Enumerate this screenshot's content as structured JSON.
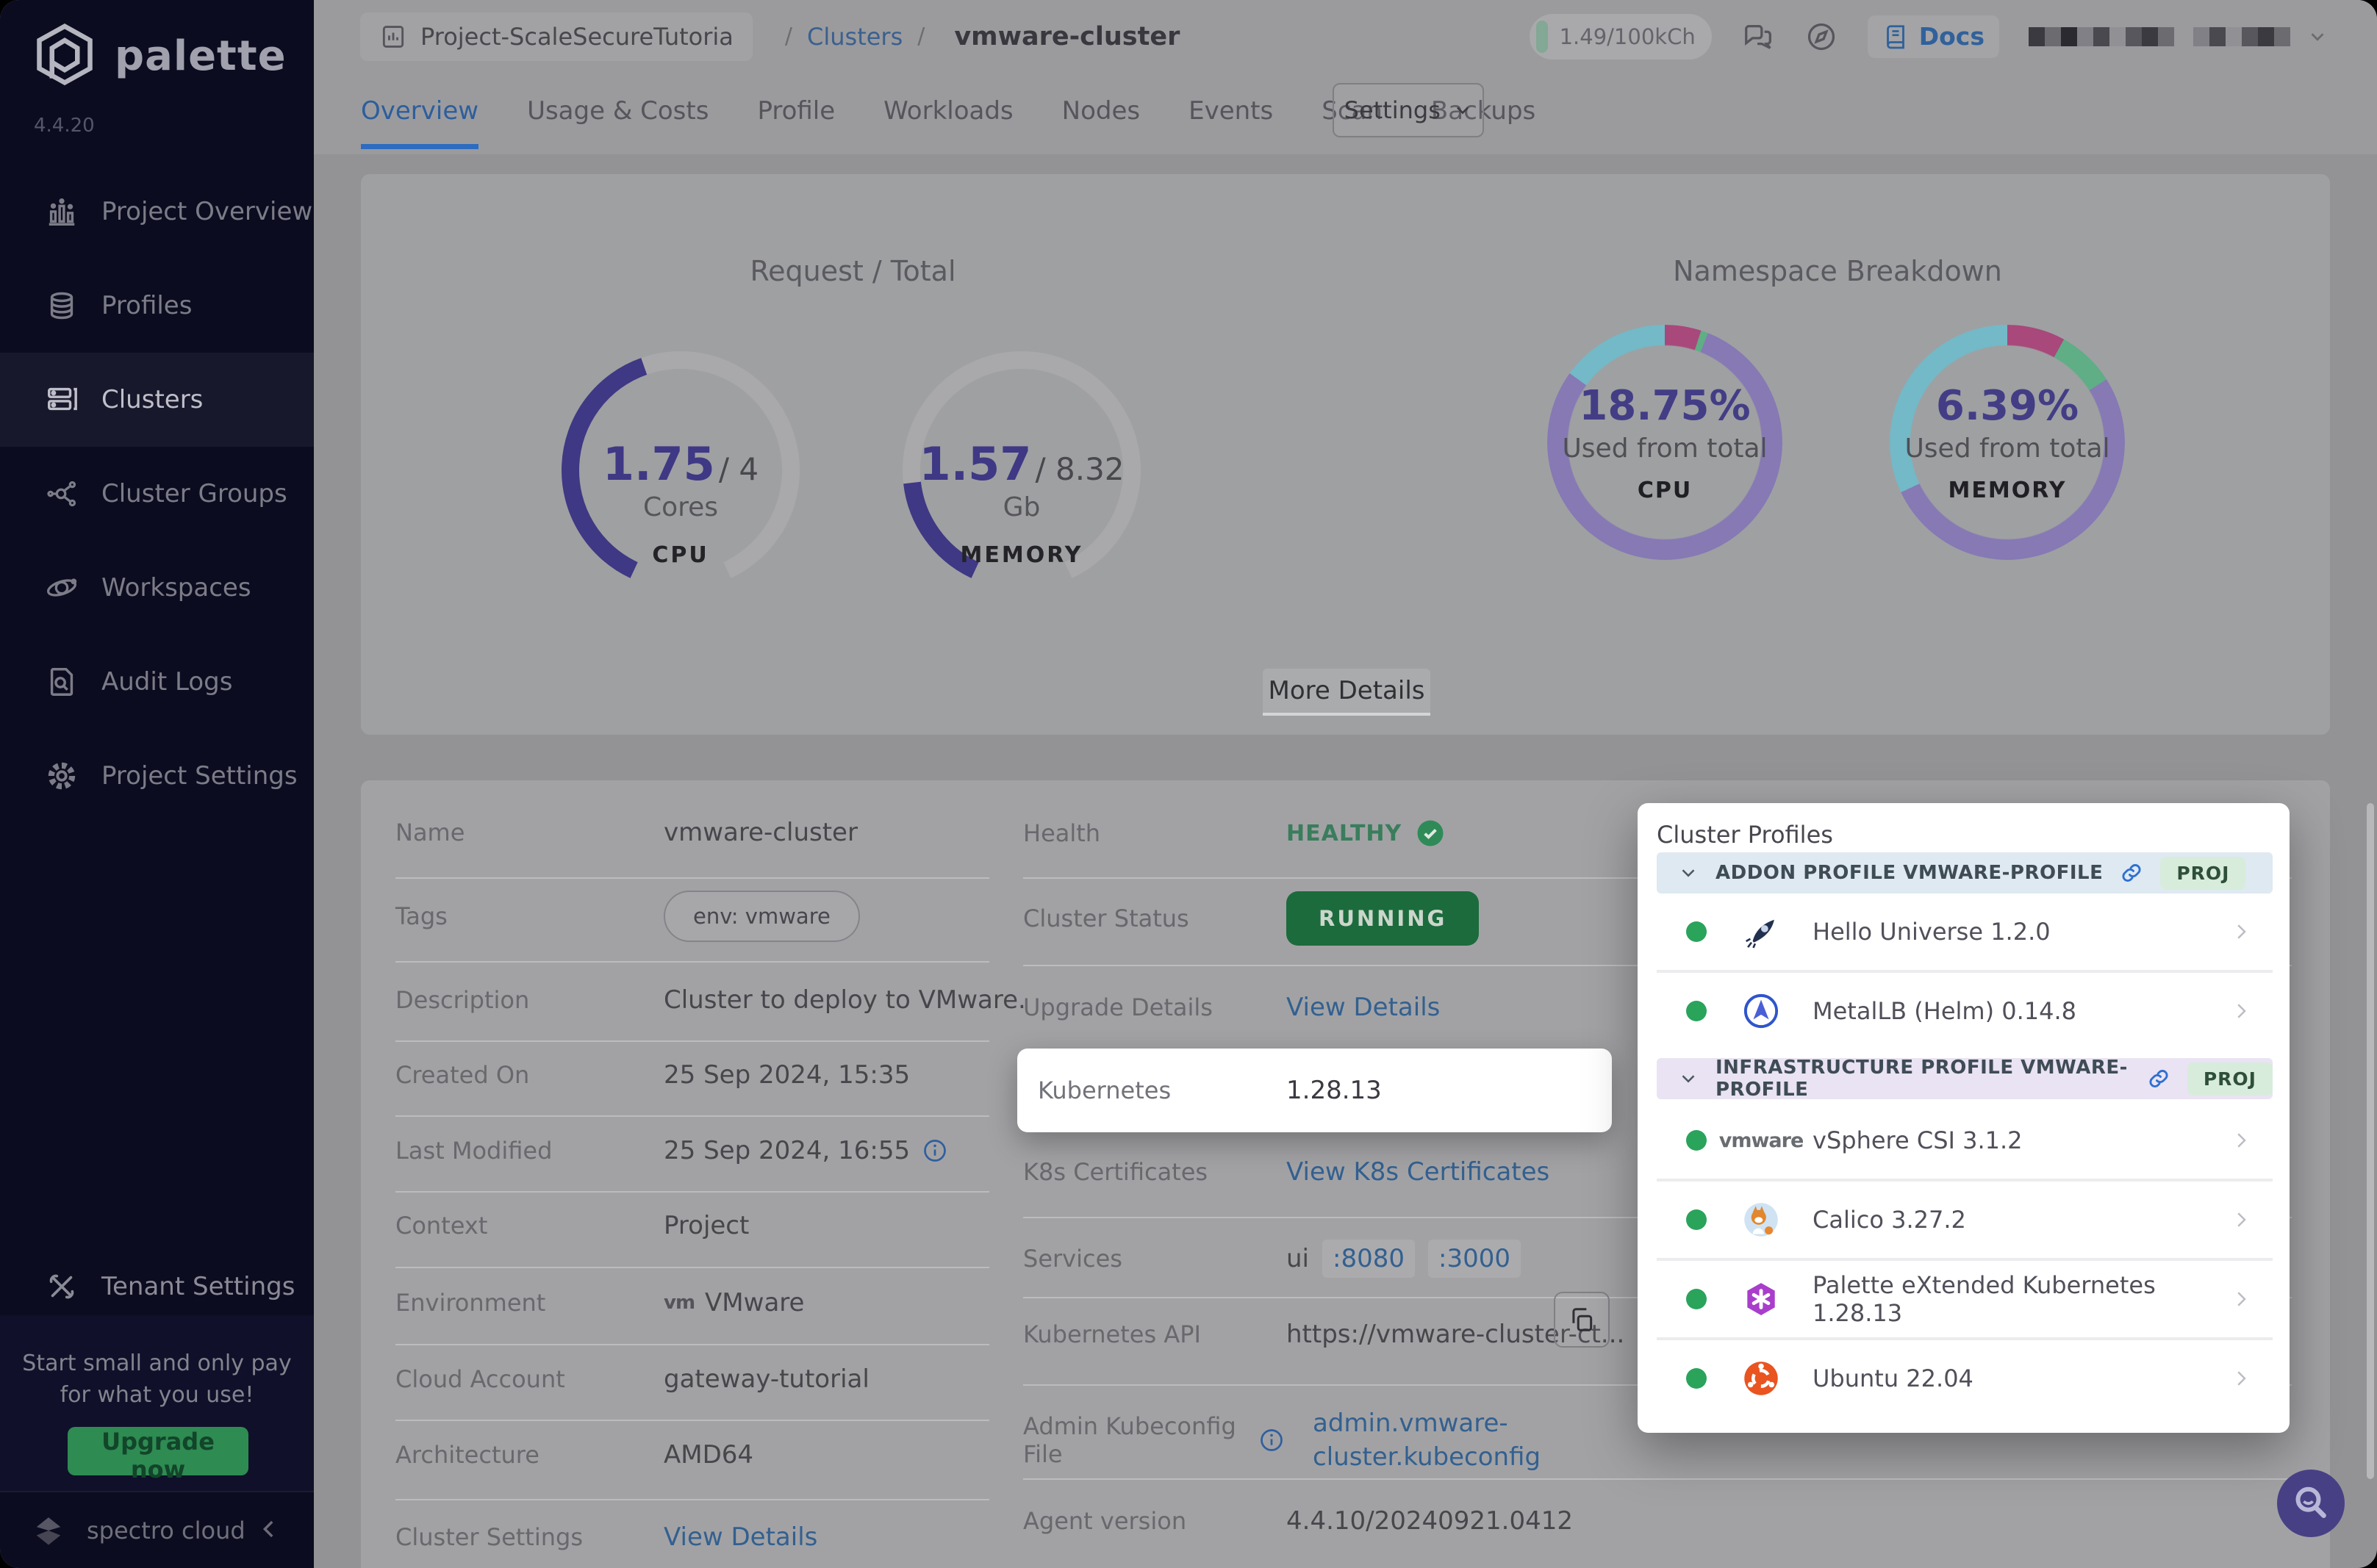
{
  "brand": {
    "name": "palette",
    "version": "4.4.20",
    "footer_company": "spectro cloud"
  },
  "sidebar": {
    "items": [
      {
        "label": "Project Overview",
        "icon": "bar-chart-icon",
        "active": false
      },
      {
        "label": "Profiles",
        "icon": "layers-icon",
        "active": false
      },
      {
        "label": "Clusters",
        "icon": "clusters-icon",
        "active": true
      },
      {
        "label": "Cluster Groups",
        "icon": "network-icon",
        "active": false
      },
      {
        "label": "Workspaces",
        "icon": "orbit-icon",
        "active": false
      },
      {
        "label": "Audit Logs",
        "icon": "audit-log-icon",
        "active": false
      },
      {
        "label": "Project Settings",
        "icon": "gear-icon",
        "active": false
      }
    ],
    "tenant_settings": {
      "label": "Tenant Settings",
      "icon": "tools-icon"
    },
    "upsell": {
      "line1": "Start small and only pay",
      "line2": "for what you use!",
      "cta": "Upgrade now"
    }
  },
  "topbar": {
    "project_chip": "Project-ScaleSecureTutoria",
    "breadcrumb": {
      "sep": "/",
      "link": "Clusters",
      "current": "vmware-cluster"
    },
    "credits": "1.49/100kCh",
    "docs_label": "Docs"
  },
  "tabs": {
    "items": [
      "Overview",
      "Usage & Costs",
      "Profile",
      "Workloads",
      "Nodes",
      "Events",
      "Scan",
      "Backups"
    ],
    "active": "Overview",
    "settings_button": "Settings"
  },
  "overview": {
    "title_left": "Request / Total",
    "title_right": "Namespace Breakdown",
    "more_details": "More Details"
  },
  "chart_data": [
    {
      "type": "gauge",
      "group": "Request / Total",
      "label": "CPU",
      "value": 1.75,
      "total": 4,
      "unit": "Cores",
      "value_display": "1.75",
      "total_display": "/ 4",
      "fill_color": "#3f3884"
    },
    {
      "type": "gauge",
      "group": "Request / Total",
      "label": "MEMORY",
      "value": 1.57,
      "total": 8.32,
      "unit": "Gb",
      "value_display": "1.57",
      "total_display": "/ 8.32",
      "fill_color": "#3f3884"
    },
    {
      "type": "donut",
      "group": "Namespace Breakdown",
      "label": "CPU",
      "center_value": "18.75%",
      "center_caption": "Used from total",
      "segments": [
        {
          "color": "#a8487b",
          "pct": 5
        },
        {
          "color": "#5fae85",
          "pct": 1
        },
        {
          "color": "#8679b4",
          "pct": 79
        },
        {
          "color": "#73b9c7",
          "pct": 15
        }
      ]
    },
    {
      "type": "donut",
      "group": "Namespace Breakdown",
      "label": "MEMORY",
      "center_value": "6.39%",
      "center_caption": "Used from total",
      "segments": [
        {
          "color": "#a8487b",
          "pct": 8
        },
        {
          "color": "#5fae85",
          "pct": 8
        },
        {
          "color": "#8679b4",
          "pct": 52
        },
        {
          "color": "#73b9c7",
          "pct": 32
        }
      ]
    }
  ],
  "details": {
    "left": [
      {
        "label": "Name",
        "value": "vmware-cluster"
      },
      {
        "label": "Tags",
        "value": "env: vmware"
      },
      {
        "label": "Description",
        "value": "Cluster to deploy to VMware."
      },
      {
        "label": "Created On",
        "value": "25 Sep 2024, 15:35"
      },
      {
        "label": "Last Modified",
        "value": "25 Sep 2024, 16:55"
      },
      {
        "label": "Context",
        "value": "Project"
      },
      {
        "label": "Environment",
        "value": "VMware",
        "logo": "vm"
      },
      {
        "label": "Cloud Account",
        "value": "gateway-tutorial"
      },
      {
        "label": "Architecture",
        "value": "AMD64"
      },
      {
        "label": "Cluster Settings",
        "value": "View Details"
      }
    ],
    "right": [
      {
        "label": "Health",
        "value": "HEALTHY"
      },
      {
        "label": "Cluster Status",
        "value": "RUNNING"
      },
      {
        "label": "Upgrade Details",
        "value": "View Details"
      },
      {
        "label": "Kubernetes",
        "value": "1.28.13"
      },
      {
        "label": "K8s Certificates",
        "value": "View K8s Certificates"
      },
      {
        "label": "Services",
        "name": "ui",
        "ports": [
          ":8080",
          ":3000"
        ]
      },
      {
        "label": "Kubernetes API",
        "value": "https://vmware-cluster-ct..."
      },
      {
        "label": "Admin Kubeconfig File",
        "lines": [
          "admin.vmware-",
          "cluster.kubeconfig"
        ]
      },
      {
        "label": "Agent version",
        "value": "4.4.10/20240921.0412"
      }
    ]
  },
  "profiles_panel": {
    "title": "Cluster Profiles",
    "sections": [
      {
        "header": "ADDON PROFILE VMWARE-PROFILE",
        "badge": "PROJ",
        "items": [
          {
            "name": "Hello Universe 1.2.0",
            "icon": "hello-universe-icon",
            "status": "green"
          },
          {
            "name": "MetalLB (Helm) 0.14.8",
            "icon": "metallb-icon",
            "status": "green"
          }
        ]
      },
      {
        "header": "INFRASTRUCTURE PROFILE VMWARE-PROFILE",
        "badge": "PROJ",
        "items": [
          {
            "name": "vSphere CSI 3.1.2",
            "icon": "vmware-icon",
            "status": "green"
          },
          {
            "name": "Calico 3.27.2",
            "icon": "calico-icon",
            "status": "green"
          },
          {
            "name": "Palette eXtended Kubernetes 1.28.13",
            "icon": "pxk-icon",
            "status": "green"
          },
          {
            "name": "Ubuntu 22.04",
            "icon": "ubuntu-icon",
            "status": "green"
          }
        ]
      }
    ]
  },
  "colors": {
    "sidebar_bg": "#0c0c20",
    "accent_blue": "#2d6cc0",
    "link_blue": "#33608f",
    "status_green": "#2aa35b",
    "running_green": "#1c6b3c",
    "gauge_purple": "#3f3884",
    "donut_purple": "#8679b4",
    "donut_teal": "#73b9c7",
    "donut_pink": "#a8487b",
    "donut_green": "#5fae85",
    "upgrade_green": "#2e8b52",
    "fab_purple": "#474084"
  }
}
